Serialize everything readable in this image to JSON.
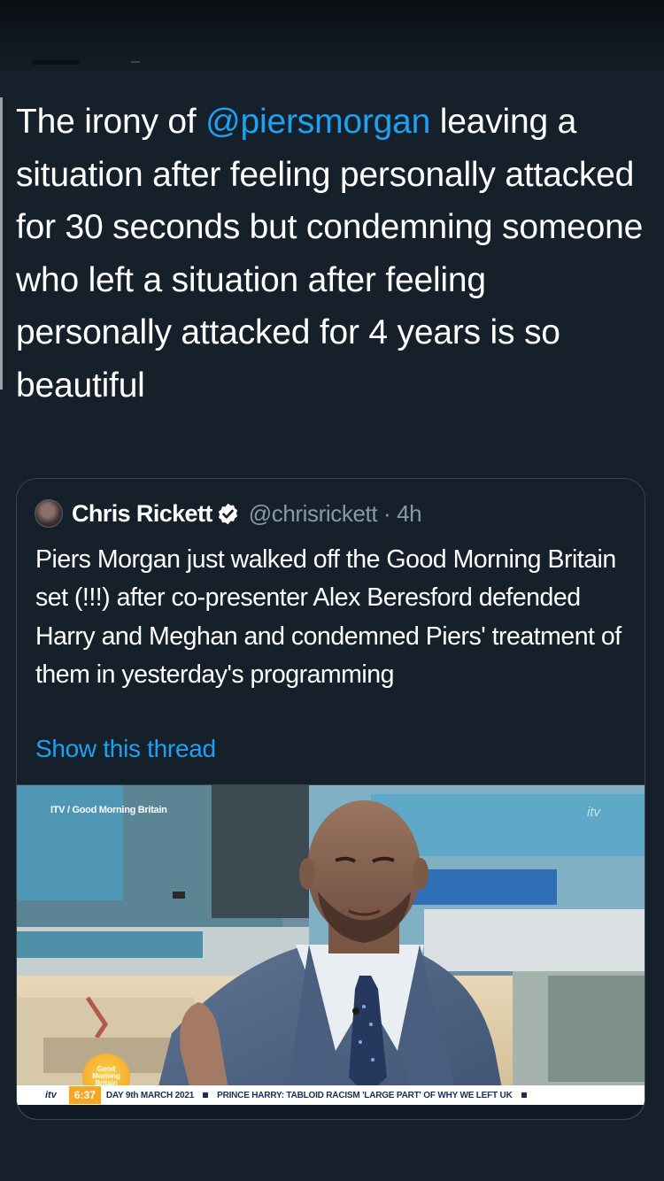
{
  "tweet": {
    "text_before": "The irony of ",
    "mention": "@piersmorgan",
    "text_after": " leaving a situation after feeling personally attacked for 30 seconds but condemning someone who left a situation after feeling personally attacked for 4 years is so beautiful"
  },
  "quoted_tweet": {
    "author_name": "Chris Rickett",
    "handle": "@chrisrickett",
    "separator": "·",
    "time": "4h",
    "text": "Piers Morgan just walked off the Good Morning Britain set (!!!) after co-presenter Alex Beresford defended Harry and Meghan and condemned Piers' treatment of them in yesterday's programming",
    "show_thread": "Show this thread",
    "media": {
      "caption": "ITV / Good Morning Britain",
      "channel_logo": "itv",
      "programme_logo": "Good Morning Britain",
      "ticker": {
        "channel": "itv",
        "time": "6:37",
        "date": "DAY 9th MARCH 2021",
        "headline": "PRINCE HARRY: TABLOID RACISM 'LARGE PART' OF WHY WE LEFT UK"
      }
    }
  },
  "icons": {
    "verified": "verified-badge-icon",
    "avatar": "avatar"
  },
  "colors": {
    "background": "#15202b",
    "link": "#1da1f2",
    "secondary_text": "#8899a6",
    "border": "#38444d"
  }
}
